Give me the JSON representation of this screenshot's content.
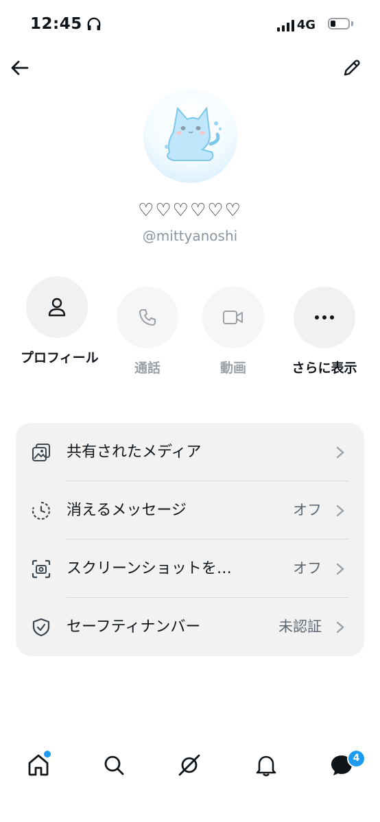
{
  "status_bar": {
    "time": "12:45",
    "network": "4G",
    "battery_level": 0.2,
    "icons": [
      "headphones-icon",
      "signal-icon",
      "battery-icon"
    ]
  },
  "header": {
    "back_icon": "arrow-left-icon",
    "edit_icon": "pencil-icon"
  },
  "profile": {
    "display_name": "♡♡♡♡♡♡",
    "handle": "@mittyanoshi"
  },
  "actions": [
    {
      "label": "プロフィール",
      "icon": "person-icon",
      "enabled": true
    },
    {
      "label": "通話",
      "icon": "phone-icon",
      "enabled": false
    },
    {
      "label": "動画",
      "icon": "video-icon",
      "enabled": false
    },
    {
      "label": "さらに表示",
      "icon": "more-icon",
      "enabled": true
    }
  ],
  "settings": [
    {
      "title": "共有されたメディア",
      "value": "",
      "icon": "media-icon"
    },
    {
      "title": "消えるメッセージ",
      "value": "オフ",
      "icon": "timer-icon"
    },
    {
      "title": "スクリーンショットを…",
      "value": "オフ",
      "icon": "screenshot-icon"
    },
    {
      "title": "セーフティナンバー",
      "value": "未認証",
      "icon": "shield-icon"
    }
  ],
  "bottom_nav": {
    "items": [
      "home-icon",
      "search-icon",
      "grok-icon",
      "bell-icon",
      "messages-icon"
    ],
    "messages_badge": "4"
  },
  "colors": {
    "accent": "#1d9bf0",
    "card_bg": "#f2f2f2",
    "secondary_text": "#8b959e"
  }
}
